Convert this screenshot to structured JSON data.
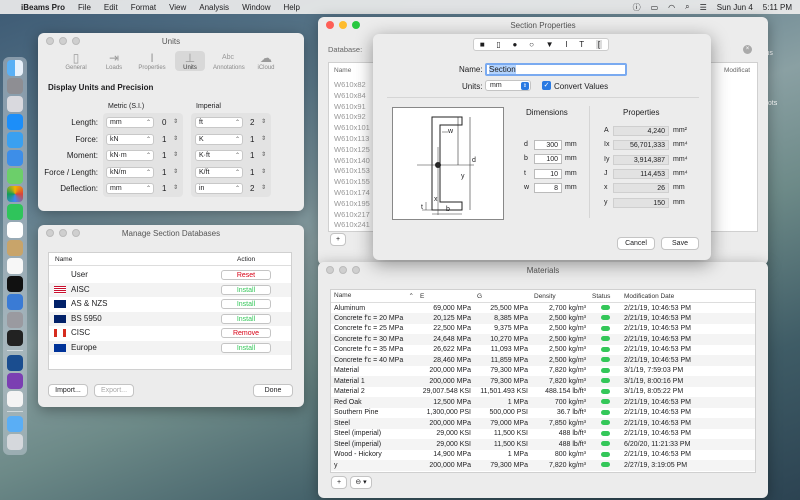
{
  "menubar": {
    "apple": "",
    "app": "iBeams Pro",
    "items": [
      "File",
      "Edit",
      "Format",
      "View",
      "Analysis",
      "Window",
      "Help"
    ],
    "date": "Sun Jun 4",
    "time": "5:11 PM"
  },
  "desktop": {
    "icon_label_1": "cus",
    "icon_label_2": "hots"
  },
  "units_window": {
    "title": "Units",
    "tabs": [
      {
        "label": "General",
        "icon": "document-icon"
      },
      {
        "label": "Loads",
        "icon": "loads-icon"
      },
      {
        "label": "Properties",
        "icon": "properties-icon"
      },
      {
        "label": "Units",
        "icon": "units-icon"
      },
      {
        "label": "Annotations",
        "icon": "annotations-icon",
        "badge": "Abc"
      },
      {
        "label": "iCloud",
        "icon": "cloud-icon"
      }
    ],
    "section_title": "Display Units and Precision",
    "col_metric": "Metric (S.I.)",
    "col_imperial": "Imperial",
    "rows": [
      {
        "label": "Length:",
        "metric": "mm",
        "metric_prec": "0",
        "imperial": "ft",
        "imperial_prec": "2"
      },
      {
        "label": "Force:",
        "metric": "kN",
        "metric_prec": "1",
        "imperial": "K",
        "imperial_prec": "1"
      },
      {
        "label": "Moment:",
        "metric": "kN·m",
        "metric_prec": "1",
        "imperial": "K·ft",
        "imperial_prec": "1"
      },
      {
        "label": "Force / Length:",
        "metric": "kN/m",
        "metric_prec": "1",
        "imperial": "K/ft",
        "imperial_prec": "1"
      },
      {
        "label": "Deflection:",
        "metric": "mm",
        "metric_prec": "1",
        "imperial": "in",
        "imperial_prec": "2"
      }
    ]
  },
  "db_window": {
    "title": "Manage Section Databases",
    "col_name": "Name",
    "col_action": "Action",
    "rows": [
      {
        "name": "User",
        "action": "Reset",
        "flag": ""
      },
      {
        "name": "AISC",
        "action": "Install",
        "flag": "us"
      },
      {
        "name": "AS & NZS",
        "action": "Install",
        "flag": "au"
      },
      {
        "name": "BS 5950",
        "action": "Install",
        "flag": "uk"
      },
      {
        "name": "CISC",
        "action": "Remove",
        "flag": "ca"
      },
      {
        "name": "Europe",
        "action": "Install",
        "flag": "eu"
      }
    ],
    "import_label": "Import...",
    "export_label": "Export...",
    "done_label": "Done"
  },
  "section_props_window": {
    "title": "Section Properties",
    "database_label": "Database:",
    "name_header": "Name",
    "modification_header": "Modificat",
    "names": [
      "W610x82",
      "W610x84",
      "W610x91",
      "W610x92",
      "W610x101",
      "W610x113",
      "W610x125",
      "W610x140",
      "W610x153",
      "W610x155",
      "W610x174",
      "W610x195",
      "W610x217",
      "W610x241"
    ],
    "add_label": "+"
  },
  "sheet": {
    "name_label": "Name:",
    "name_value": "Section",
    "units_label": "Units:",
    "units_value": "mm",
    "convert_label": "Convert Values",
    "convert_checked": true,
    "dims_title": "Dimensions",
    "dims": [
      {
        "sym": "d",
        "val": "300",
        "unit": "mm"
      },
      {
        "sym": "b",
        "val": "100",
        "unit": "mm"
      },
      {
        "sym": "t",
        "val": "10",
        "unit": "mm"
      },
      {
        "sym": "w",
        "val": "8",
        "unit": "mm"
      }
    ],
    "props_title": "Properties",
    "props": [
      {
        "sym": "A",
        "val": "4,240",
        "unit": "mm²"
      },
      {
        "sym": "Ix",
        "val": "56,701,333",
        "unit": "mm⁴"
      },
      {
        "sym": "Iy",
        "val": "3,914,387",
        "unit": "mm⁴"
      },
      {
        "sym": "J",
        "val": "114,453",
        "unit": "mm⁴"
      },
      {
        "sym": "x",
        "val": "26",
        "unit": "mm"
      },
      {
        "sym": "y",
        "val": "150",
        "unit": "mm"
      }
    ],
    "diagram_labels": {
      "w": "w",
      "d": "d",
      "x": "x",
      "y": "y",
      "t": "t",
      "b": "b"
    },
    "cancel_label": "Cancel",
    "save_label": "Save"
  },
  "materials_window": {
    "title": "Materials",
    "headers": {
      "name": "Name",
      "e": "E",
      "g": "G",
      "density": "Density",
      "status": "Status",
      "mod": "Modification Date"
    },
    "rows": [
      {
        "name": "Aluminum",
        "e": "69,000 MPa",
        "g": "25,500 MPa",
        "density": "2,700 kg/m³",
        "mod": "2/21/19, 10:46:53 PM"
      },
      {
        "name": "Concrete f'c = 20 MPa",
        "e": "20,125 MPa",
        "g": "8,385 MPa",
        "density": "2,500 kg/m³",
        "mod": "2/21/19, 10:46:53 PM"
      },
      {
        "name": "Concrete f'c = 25 MPa",
        "e": "22,500 MPa",
        "g": "9,375 MPa",
        "density": "2,500 kg/m³",
        "mod": "2/21/19, 10:46:53 PM"
      },
      {
        "name": "Concrete f'c = 30 MPa",
        "e": "24,648 MPa",
        "g": "10,270 MPa",
        "density": "2,500 kg/m³",
        "mod": "2/21/19, 10:46:53 PM"
      },
      {
        "name": "Concrete f'c = 35 MPa",
        "e": "26,622 MPa",
        "g": "11,093 MPa",
        "density": "2,500 kg/m³",
        "mod": "2/21/19, 10:46:53 PM"
      },
      {
        "name": "Concrete f'c = 40 MPa",
        "e": "28,460 MPa",
        "g": "11,859 MPa",
        "density": "2,500 kg/m³",
        "mod": "2/21/19, 10:46:53 PM"
      },
      {
        "name": "Material",
        "e": "200,000 MPa",
        "g": "79,300 MPa",
        "density": "7,820 kg/m³",
        "mod": "3/1/19, 7:59:03 PM"
      },
      {
        "name": "Material 1",
        "e": "200,000 MPa",
        "g": "79,300 MPa",
        "density": "7,820 kg/m³",
        "mod": "3/1/19, 8:00:16 PM"
      },
      {
        "name": "Material 2",
        "e": "29,007.548 KSI",
        "g": "11,501.493 KSI",
        "density": "488.154 lb/ft³",
        "mod": "3/1/19, 8:05:22 PM"
      },
      {
        "name": "Red Oak",
        "e": "12,500 MPa",
        "g": "1 MPa",
        "density": "700 kg/m³",
        "mod": "2/21/19, 10:46:53 PM"
      },
      {
        "name": "Southern Pine",
        "e": "1,300,000 PSI",
        "g": "500,000 PSI",
        "density": "36.7 lb/ft³",
        "mod": "2/21/19, 10:46:53 PM"
      },
      {
        "name": "Steel",
        "e": "200,000 MPa",
        "g": "79,000 MPa",
        "density": "7,850 kg/m³",
        "mod": "2/21/19, 10:46:53 PM"
      },
      {
        "name": "Steel (imperial)",
        "e": "29,000 KSI",
        "g": "11,500 KSI",
        "density": "488 lb/ft³",
        "mod": "2/21/19, 10:46:53 PM"
      },
      {
        "name": "Steel (imperial)",
        "e": "29,000 KSI",
        "g": "11,500 KSI",
        "density": "488 lb/ft³",
        "mod": "6/20/20, 11:21:33 PM"
      },
      {
        "name": "Wood - Hickory",
        "e": "14,900 MPa",
        "g": "1 MPa",
        "density": "800 kg/m³",
        "mod": "2/21/19, 10:46:53 PM"
      },
      {
        "name": "y",
        "e": "200,000 MPa",
        "g": "79,300 MPa",
        "density": "7,820 kg/m³",
        "mod": "2/27/19, 3:19:05 PM"
      }
    ],
    "add_label": "+",
    "more_label": "⊖ ▾"
  },
  "colors": {
    "accent": "#1a73e8",
    "install_green": "#34c759",
    "remove_red": "#d70015"
  }
}
